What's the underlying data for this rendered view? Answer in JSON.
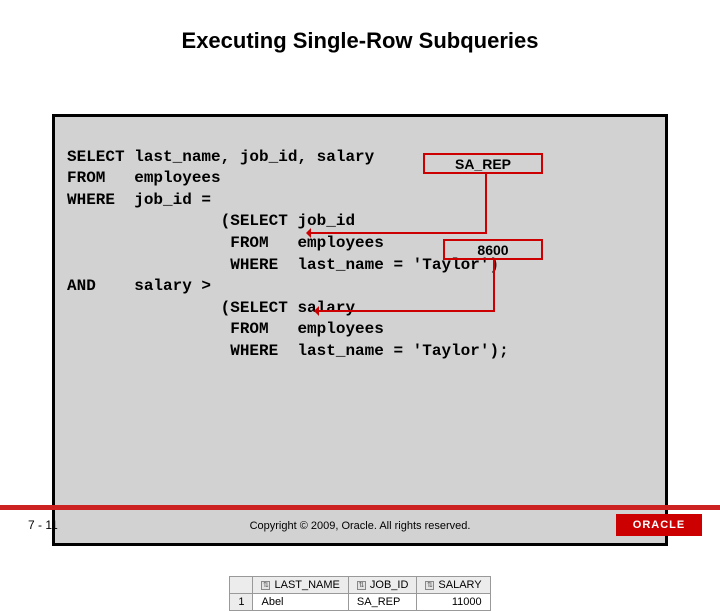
{
  "title": "Executing Single-Row Subqueries",
  "code": {
    "l1": "SELECT last_name, job_id, salary",
    "l2": "FROM   employees",
    "l3": "WHERE  job_id =",
    "l4": "                (SELECT job_id",
    "l5": "                 FROM   employees",
    "l6": "                 WHERE  last_name = 'Taylor')",
    "l7": "AND    salary >",
    "l8": "                (SELECT salary",
    "l9": "                 FROM   employees",
    "l10": "                 WHERE  last_name = 'Taylor');"
  },
  "annotations": {
    "sub1_value": "SA_REP",
    "sub2_value": "8600"
  },
  "result": {
    "headers": {
      "last_name": "LAST_NAME",
      "job_id": "JOB_ID",
      "salary": "SALARY"
    },
    "rownum": "1",
    "row": {
      "last_name": "Abel",
      "job_id": "SA_REP",
      "salary": "11000"
    }
  },
  "footer": {
    "page": "7 - 11",
    "copyright": "Copyright © 2009, Oracle. All rights reserved.",
    "logo": "ORACLE"
  }
}
